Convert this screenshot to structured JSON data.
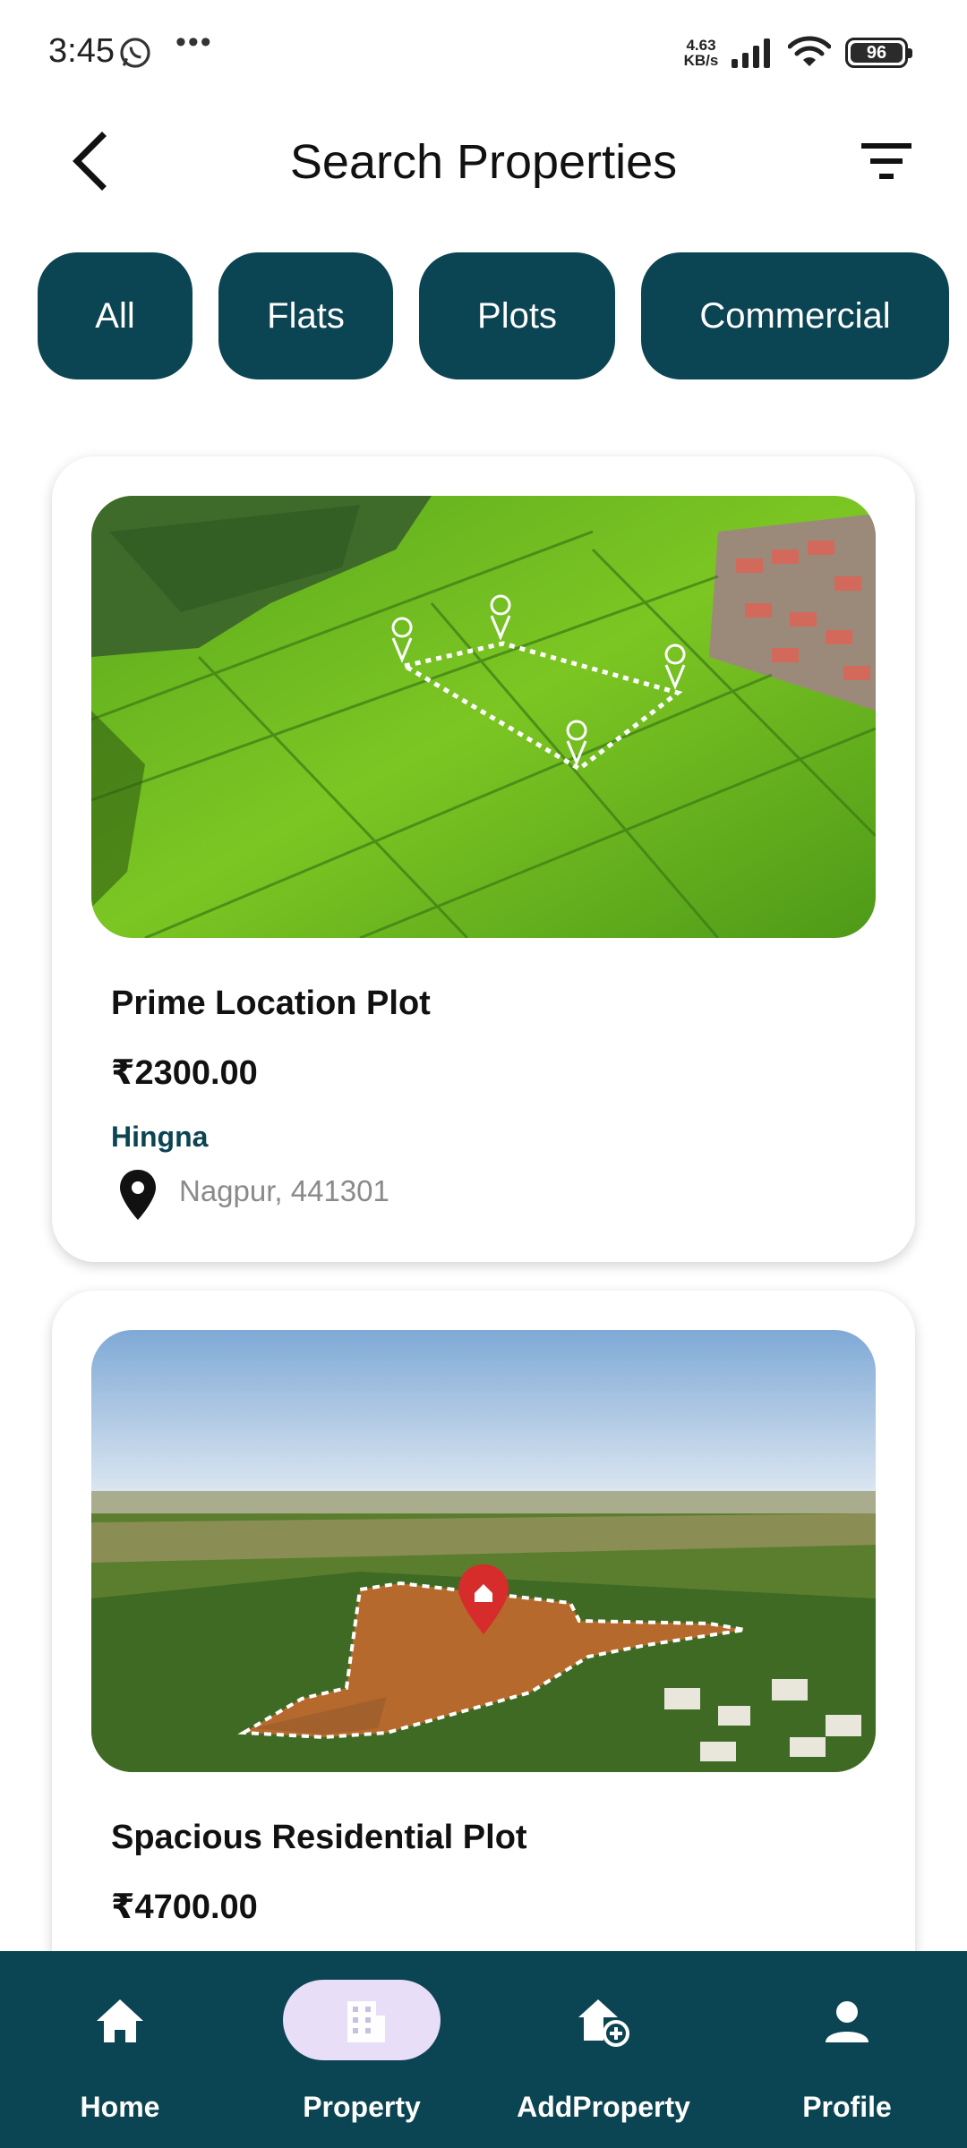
{
  "status_bar": {
    "time": "3:45",
    "speed_value": "4.63",
    "speed_unit": "KB/s",
    "battery": "96",
    "icons": [
      "whatsapp-icon",
      "more-dots-icon",
      "signal-icon",
      "wifi-icon",
      "battery-icon"
    ]
  },
  "header": {
    "title": "Search Properties",
    "back_icon": "chevron-left-icon",
    "filter_icon": "filter-icon"
  },
  "categories": [
    {
      "label": "All"
    },
    {
      "label": "Flats"
    },
    {
      "label": "Plots"
    },
    {
      "label": "Commercial"
    }
  ],
  "listings": [
    {
      "title": "Prime Location Plot",
      "price": "₹2300.00",
      "area": "Hingna",
      "location": "Nagpur, 441301"
    },
    {
      "title": "Spacious Residential Plot",
      "price": "₹4700.00"
    }
  ],
  "bottom_nav": {
    "items": [
      {
        "label": "Home",
        "icon": "home-icon",
        "active": false
      },
      {
        "label": "Property",
        "icon": "building-icon",
        "active": true
      },
      {
        "label": "AddProperty",
        "icon": "add-home-icon",
        "active": false
      },
      {
        "label": "Profile",
        "icon": "person-icon",
        "active": false
      }
    ]
  },
  "colors": {
    "primary": "#0b4452",
    "active_pill": "#e8def8",
    "muted_text": "#8a8a8a"
  }
}
